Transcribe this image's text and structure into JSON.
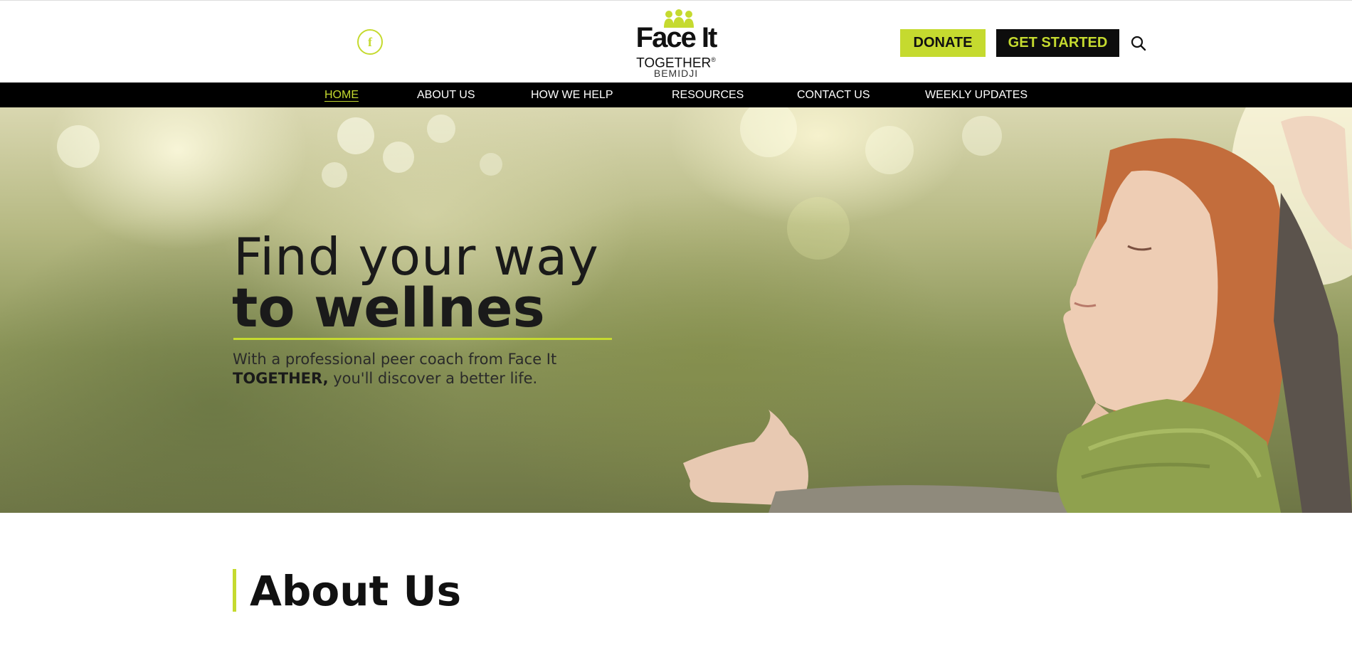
{
  "header": {
    "social": {
      "icon": "facebook-icon",
      "glyph": "f"
    },
    "logo": {
      "line1": "Face It",
      "line2": "TOGETHER",
      "registered": "®",
      "city": "BEMIDJI"
    },
    "donate_label": "DONATE",
    "get_started_label": "GET STARTED",
    "search_icon": "search-icon"
  },
  "nav": {
    "items": [
      {
        "label": "HOME",
        "active": true
      },
      {
        "label": "ABOUT US",
        "active": false
      },
      {
        "label": "HOW WE HELP",
        "active": false
      },
      {
        "label": "RESOURCES",
        "active": false
      },
      {
        "label": "CONTACT US",
        "active": false
      },
      {
        "label": "WEEKLY UPDATES",
        "active": false
      }
    ]
  },
  "hero": {
    "line1": "Find your way",
    "line2": "to wellnes",
    "sub_text_1": "With a professional peer coach from Face It",
    "sub_bold": "TOGETHER,",
    "sub_text_2": " you'll discover a better life."
  },
  "about": {
    "title_light": "About ",
    "title_bold": "Us"
  },
  "colors": {
    "accent": "#c5da2f",
    "dark": "#0d0d0d",
    "nav_bg": "#000000",
    "white": "#ffffff"
  }
}
